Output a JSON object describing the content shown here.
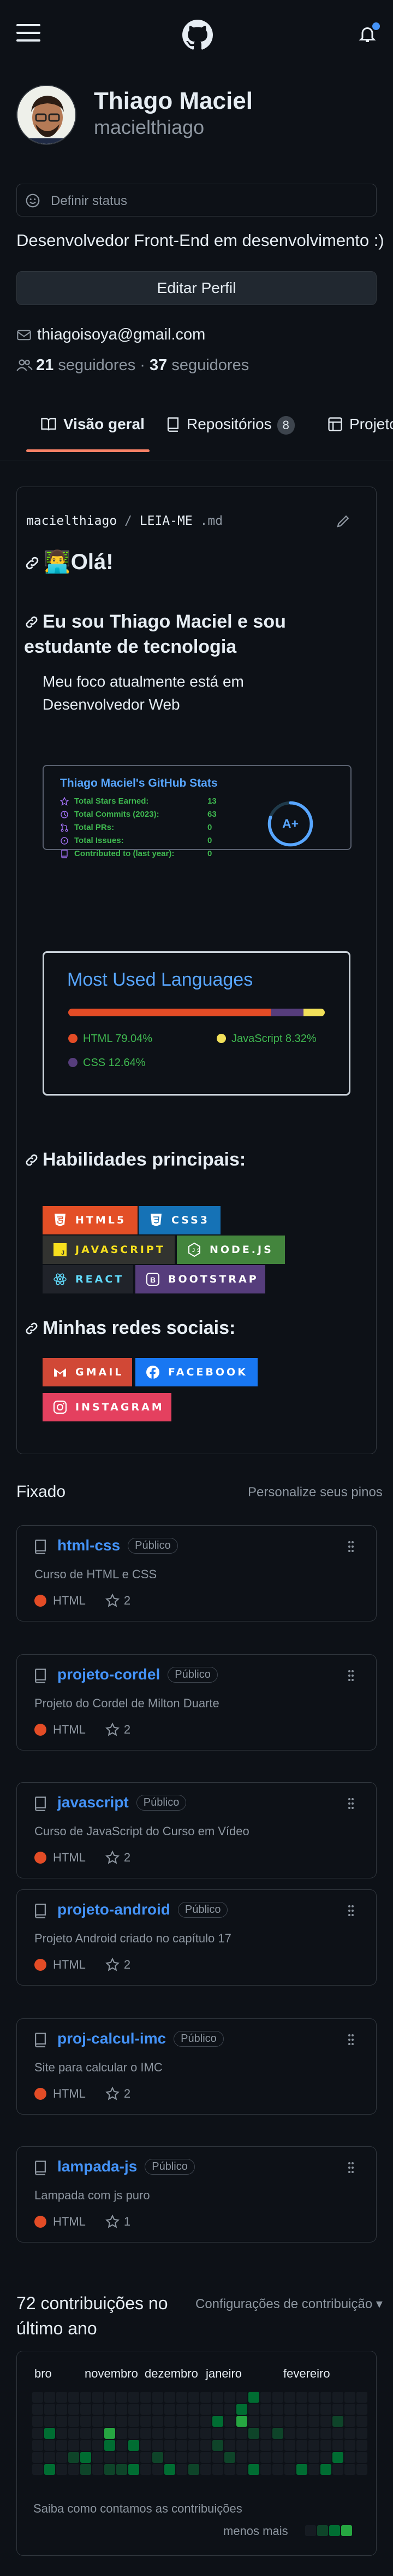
{
  "header": {
    "icons": [
      "hamburger-icon",
      "github-logo-icon",
      "bell-icon"
    ]
  },
  "profile": {
    "name": "Thiago Maciel",
    "login": "macielthiago",
    "status_placeholder": "Definir status",
    "bio": "Desenvolvedor Front-End em desenvolvimento :)",
    "edit_label": "Editar Perfil",
    "email": "thiagoisoya@gmail.com",
    "followers_count": "21",
    "followers_label": "seguidores",
    "following_count": "37",
    "following_label": "seguidores",
    "dot": "·"
  },
  "tabs": [
    {
      "label": "Visão geral",
      "active": true
    },
    {
      "label": "Repositórios",
      "count": "8"
    },
    {
      "label": "Projetos"
    }
  ],
  "readme": {
    "path_user": "macielthiago",
    "path_sep": "/",
    "path_file": "LEIA-ME",
    "path_ext": ".md",
    "hello": "👨‍💻Olá!",
    "about_heading": "Eu sou Thiago Maciel e sou estudante de tecnologia",
    "about_text": "Meu foco atualmente está em Desenvolvedor Web",
    "stats": {
      "title": "Thiago Maciel's GitHub Stats",
      "rows": [
        {
          "label": "Total Stars Earned:",
          "value": "13"
        },
        {
          "label": "Total Commits (2023):",
          "value": "63"
        },
        {
          "label": "Total PRs:",
          "value": "0"
        },
        {
          "label": "Total Issues:",
          "value": "0"
        },
        {
          "label": "Contributed to (last year):",
          "value": "0"
        }
      ],
      "grade": "A+",
      "grade_fraction": 0.8
    },
    "langs": {
      "title": "Most Used Languages",
      "items": [
        {
          "label": "HTML 79.04%",
          "value": 79.04,
          "color": "#e34c26"
        },
        {
          "label": "JavaScript 8.32%",
          "value": 8.32,
          "color": "#f1e05a"
        },
        {
          "label": "CSS 12.64%",
          "value": 12.64,
          "color": "#563d7c"
        }
      ]
    },
    "skills_heading": "Habilidades principais:",
    "skills": [
      {
        "label": "HTML5",
        "color": "#e34f26",
        "icon": "html5-icon"
      },
      {
        "label": "CSS3",
        "color": "#1572b6",
        "icon": "css3-icon"
      },
      {
        "label": "JAVASCRIPT",
        "color": "#323330",
        "icon": "javascript-icon"
      },
      {
        "label": "NODE.JS",
        "color": "#43853d",
        "icon": "nodejs-icon"
      },
      {
        "label": "REACT",
        "color": "#20232a",
        "icon": "react-icon"
      },
      {
        "label": "BOOTSTRAP",
        "color": "#563d7c",
        "icon": "bootstrap-icon"
      }
    ],
    "social_heading": "Minhas redes sociais:",
    "social": [
      {
        "label": "GMAIL",
        "color": "#d14836",
        "icon": "gmail-icon"
      },
      {
        "label": "FACEBOOK",
        "color": "#1877f2",
        "icon": "facebook-icon"
      },
      {
        "label": "INSTAGRAM",
        "color": "#e4405f",
        "icon": "instagram-icon"
      }
    ]
  },
  "pinned": {
    "title": "Fixado",
    "customize": "Personalize seus pinos",
    "public_label": "Público",
    "items": [
      {
        "name": "html-css",
        "desc": "Curso de HTML e CSS",
        "lang": "HTML",
        "stars": "2"
      },
      {
        "name": "projeto-cordel",
        "desc": "Projeto do Cordel de Milton Duarte",
        "lang": "HTML",
        "stars": "2"
      },
      {
        "name": "javascript",
        "desc": "Curso de JavaScript do Curso em Vídeo",
        "lang": "HTML",
        "stars": "2"
      },
      {
        "name": "projeto-android",
        "desc": "Projeto Android criado no capítulo 17",
        "lang": "HTML",
        "stars": "2"
      },
      {
        "name": "proj-calcul-imc",
        "desc": "Site para calcular o IMC",
        "lang": "HTML",
        "stars": "2"
      },
      {
        "name": "lampada-js",
        "desc": "Lampada com js puro",
        "lang": "HTML",
        "stars": "1"
      }
    ]
  },
  "contributions": {
    "title": "72 contribuições no último ano",
    "settings": "Configurações de contribuição",
    "months": [
      "bro",
      "novembro",
      "dezembro",
      "janeiro",
      "fevereiro"
    ],
    "footer": "Saiba como contamos as contribuições",
    "less": "menos mais",
    "colors": {
      "empty": "#161b22",
      "l1": "#0e4429",
      "l2": "#006d32",
      "l3": "#26a641"
    }
  }
}
